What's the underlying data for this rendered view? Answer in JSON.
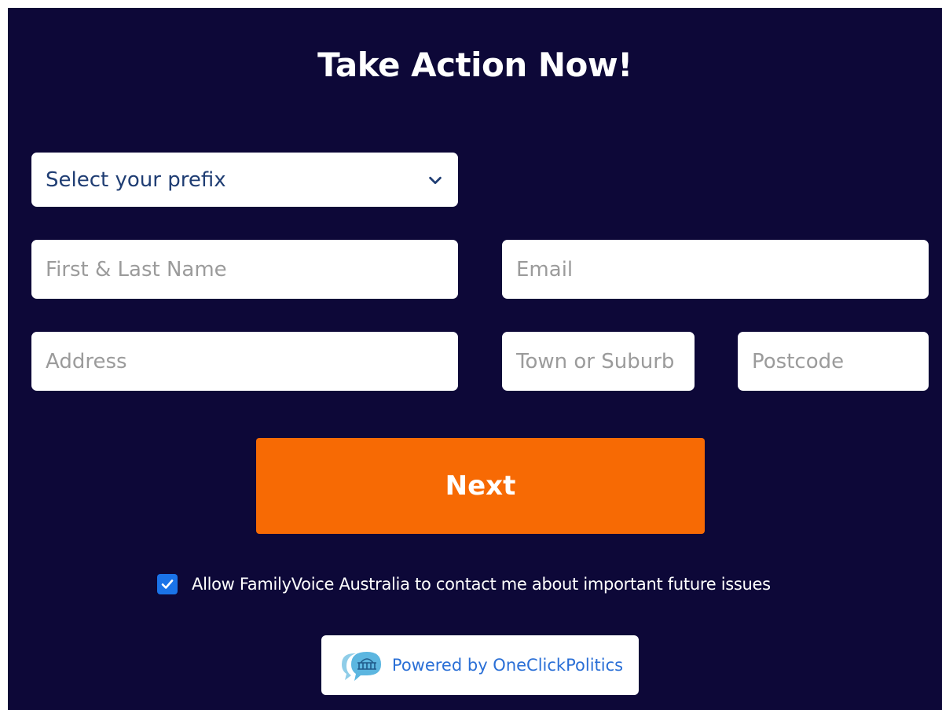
{
  "form": {
    "title": "Take Action Now!",
    "prefix_select": {
      "value": "Select your prefix"
    },
    "name_placeholder": "First & Last Name",
    "email_placeholder": "Email",
    "address_placeholder": "Address",
    "town_placeholder": "Town or Suburb",
    "postcode_placeholder": "Postcode",
    "next_label": "Next",
    "consent": {
      "checked": true,
      "label": "Allow FamilyVoice Australia to contact me about important future issues"
    },
    "powered_by": "Powered by OneClickPolitics"
  },
  "colors": {
    "background": "#0d0838",
    "button": "#f76a04",
    "checkbox": "#1a73e8",
    "link": "#2a6fd6"
  },
  "icons": [
    "chevron-down-icon",
    "checkmark-icon",
    "oneclickpolitics-logo-icon"
  ]
}
